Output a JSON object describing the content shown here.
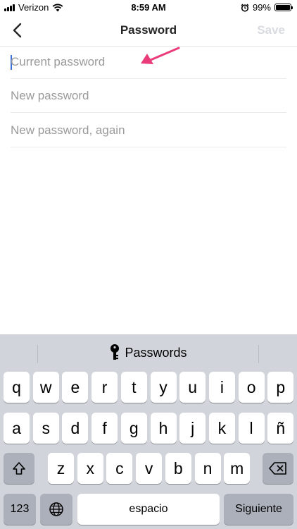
{
  "status_bar": {
    "carrier": "Verizon",
    "time": "8:59 AM",
    "battery": "99%",
    "battery_level": 0.99
  },
  "nav": {
    "title": "Password",
    "save_label": "Save"
  },
  "fields": {
    "current_password": {
      "placeholder": "Current password",
      "value": ""
    },
    "new_password": {
      "placeholder": "New password",
      "value": ""
    },
    "new_password_again": {
      "placeholder": "New password, again",
      "value": ""
    }
  },
  "keyboard": {
    "suggestion": "Passwords",
    "row1": [
      "q",
      "w",
      "e",
      "r",
      "t",
      "y",
      "u",
      "i",
      "o",
      "p"
    ],
    "row2": [
      "a",
      "s",
      "d",
      "f",
      "g",
      "h",
      "j",
      "k",
      "l",
      "ñ"
    ],
    "row3": [
      "z",
      "x",
      "c",
      "v",
      "b",
      "n",
      "m"
    ],
    "numbers_key": "123",
    "space_key": "espacio",
    "return_key": "Siguiente"
  },
  "colors": {
    "accent_arrow": "#ea3b7a",
    "caret": "#3b6fd8",
    "keyboard_bg": "#d1d4da"
  }
}
